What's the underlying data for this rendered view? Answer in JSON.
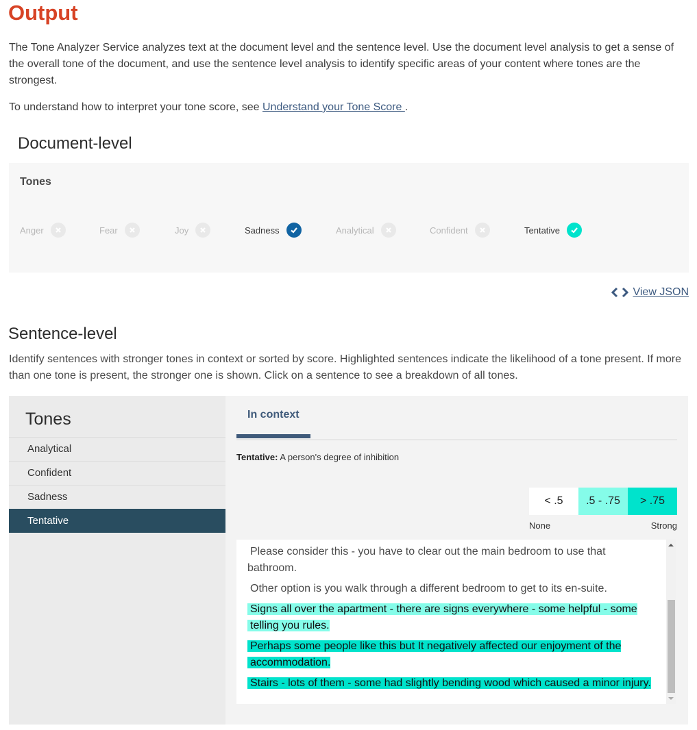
{
  "page": {
    "title": "Output",
    "intro": "The Tone Analyzer Service analyzes text at the document level and the sentence level. Use the document level analysis to get a sense of the overall tone of the document, and use the sentence level analysis to identify specific areas of your content where tones are the strongest.",
    "interpret_prefix": "To understand how to interpret your tone score, see ",
    "interpret_link": "Understand your Tone Score ",
    "interpret_suffix": "."
  },
  "document_level": {
    "heading": "Document-level",
    "tones_label": "Tones",
    "tones": [
      {
        "label": "Anger",
        "detected": false
      },
      {
        "label": "Fear",
        "detected": false
      },
      {
        "label": "Joy",
        "detected": false
      },
      {
        "label": "Sadness",
        "detected": true,
        "color": "#1164a3"
      },
      {
        "label": "Analytical",
        "detected": false
      },
      {
        "label": "Confident",
        "detected": false
      },
      {
        "label": "Tentative",
        "detected": true,
        "color": "#00e3cc"
      }
    ],
    "view_json_label": "View JSON",
    "view_json_icon": "code-brackets-icon"
  },
  "sentence_level": {
    "heading": "Sentence-level",
    "description": "Identify sentences with stronger tones in context or sorted by score. Highlighted sentences indicate the likelihood of a tone present. If more than one tone is present, the stronger one is shown. Click on a sentence to see a breakdown of all tones.",
    "sidebar": {
      "title": "Tones",
      "items": [
        {
          "label": "Analytical",
          "selected": false
        },
        {
          "label": "Confident",
          "selected": false
        },
        {
          "label": "Sadness",
          "selected": false
        },
        {
          "label": "Tentative",
          "selected": true
        }
      ]
    },
    "tab": {
      "label": "In context",
      "active": true
    },
    "tone_definition": {
      "name": "Tentative:",
      "text": " A person's degree of inhibition"
    },
    "legend": {
      "swatches": [
        {
          "label": "< .5",
          "color": "#ffffff"
        },
        {
          "label": ".5 - .75",
          "color": "#85fce9"
        },
        {
          "label": "> .75",
          "color": "#00e3cc"
        }
      ],
      "min_label": "None",
      "max_label": "Strong"
    },
    "sentences": [
      {
        "text": "Please consider this - you have to clear out the main bedroom to use that bathroom.",
        "level": "none"
      },
      {
        "text": "Other option is you walk through a different bedroom to get to its en-suite.",
        "level": "none"
      },
      {
        "text": "Signs all over the apartment - there are signs everywhere - some helpful - some telling you rules.",
        "level": "mid"
      },
      {
        "text": "Perhaps some people like this but It negatively affected our enjoyment of the accommodation.",
        "level": "strong"
      },
      {
        "text": "Stairs - lots of them - some had slightly bending wood which caused a minor injury.",
        "level": "strong"
      }
    ]
  }
}
